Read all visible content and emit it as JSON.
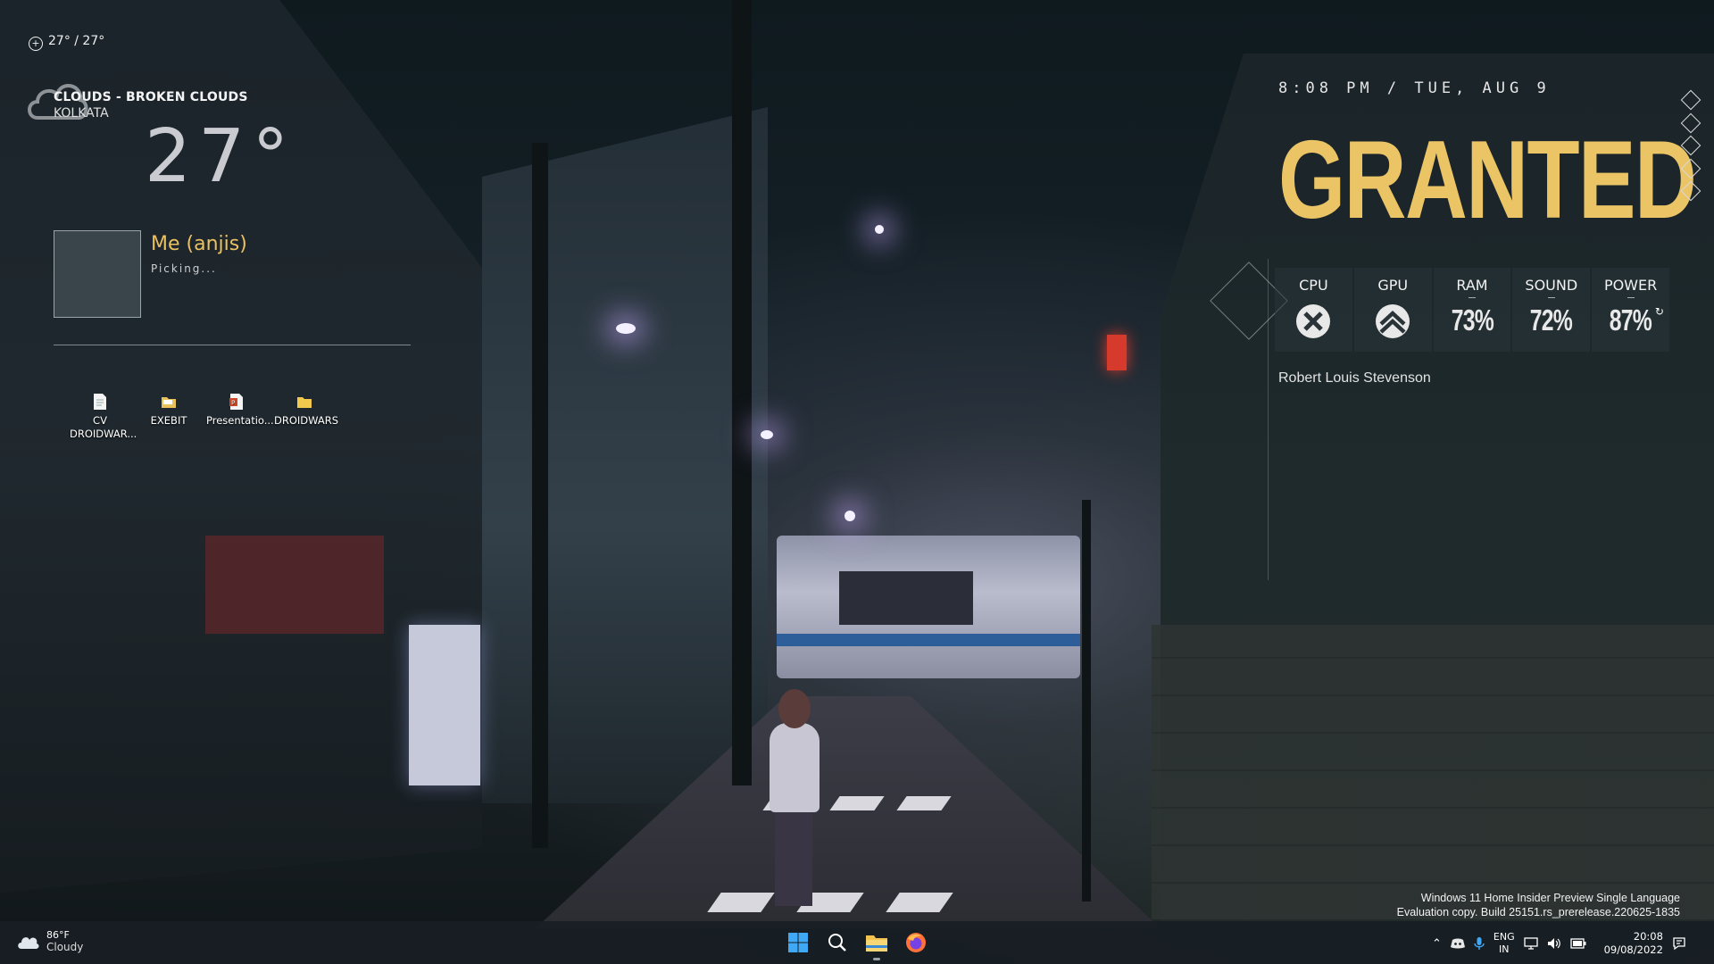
{
  "weather_widget": {
    "top_line": "27° / 27°",
    "description": "CLOUDS - BROKEN CLOUDS",
    "city": "KOLKATA",
    "temperature": "27°"
  },
  "music_widget": {
    "title": "Me (anjis)",
    "status": "Picking..."
  },
  "desktop_icons": [
    {
      "label": "CV DROIDWAR...",
      "icon": "document-icon"
    },
    {
      "label": "EXEBIT",
      "icon": "folder-icon"
    },
    {
      "label": "Presentatio...",
      "icon": "powerpoint-icon"
    },
    {
      "label": "DROIDWARS",
      "icon": "folder-icon"
    }
  ],
  "clock_widget": {
    "datetime": "8:08 PM / TUE, AUG 9",
    "headline": "GRANTED"
  },
  "system_stats": [
    {
      "label": "CPU",
      "value": "",
      "icon": "cpu-x-icon"
    },
    {
      "label": "GPU",
      "value": "",
      "icon": "gpu-chevron-icon"
    },
    {
      "label": "RAM",
      "value": "73%"
    },
    {
      "label": "SOUND",
      "value": "72%"
    },
    {
      "label": "POWER",
      "value": "87%"
    }
  ],
  "quote_author": "Robert Louis Stevenson",
  "watermark": {
    "line1": "Windows 11 Home Insider Preview Single Language",
    "line2": "Evaluation copy. Build 25151.rs_prerelease.220625-1835"
  },
  "taskbar": {
    "weather_temp": "86°F",
    "weather_desc": "Cloudy",
    "lang_top": "ENG",
    "lang_bottom": "IN",
    "time": "20:08",
    "date": "09/08/2022"
  },
  "colors": {
    "accent_gold": "#ebc466",
    "music_title": "#ebc061"
  }
}
